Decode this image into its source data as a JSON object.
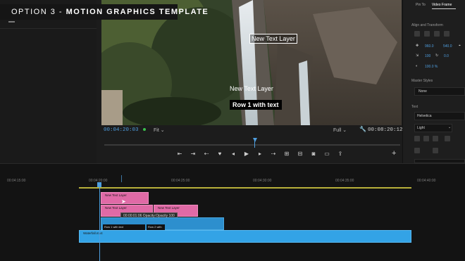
{
  "banner": {
    "prefix": "OPTION 3 - ",
    "emphasis": "MOTION GRAPHICS TEMPLATE"
  },
  "monitor": {
    "overlay_top": "New Text Layer",
    "overlay_mid": "New Text Layer",
    "overlay_row": "Row 1 with text",
    "timecode_current": "00:04:20:03",
    "zoom": "Fit",
    "resolution": "Full",
    "timecode_duration": "00:08:20:12"
  },
  "right_panel": {
    "tabs": [
      "Pin To",
      "Video Frame"
    ],
    "section_align": "Align and Transform",
    "pos_x": "960.0",
    "pos_y": "540.0",
    "rotation": "0.0",
    "scale": "100",
    "opacity": "100.0 %",
    "section_master": "Master Styles",
    "master_value": "None",
    "section_text": "Text",
    "font": "Helvetica",
    "font_style": "Light"
  },
  "timeline": {
    "ticks": [
      "00:04:15:00",
      "00:04:20:00",
      "00:04:25:00",
      "00:04:30:00",
      "00:04:35:00",
      "00:04:40:00"
    ],
    "clip_top": "New Text Layer",
    "clip_a": "New Text Layer",
    "clip_b": "New Text Layer",
    "clip_row1": "Row 1 with text",
    "clip_row2": "Row 2 with",
    "tooltip": "00:00:01:06  Opacity:Opacity  100",
    "clip_bottom": "Waterfall.mp4"
  }
}
